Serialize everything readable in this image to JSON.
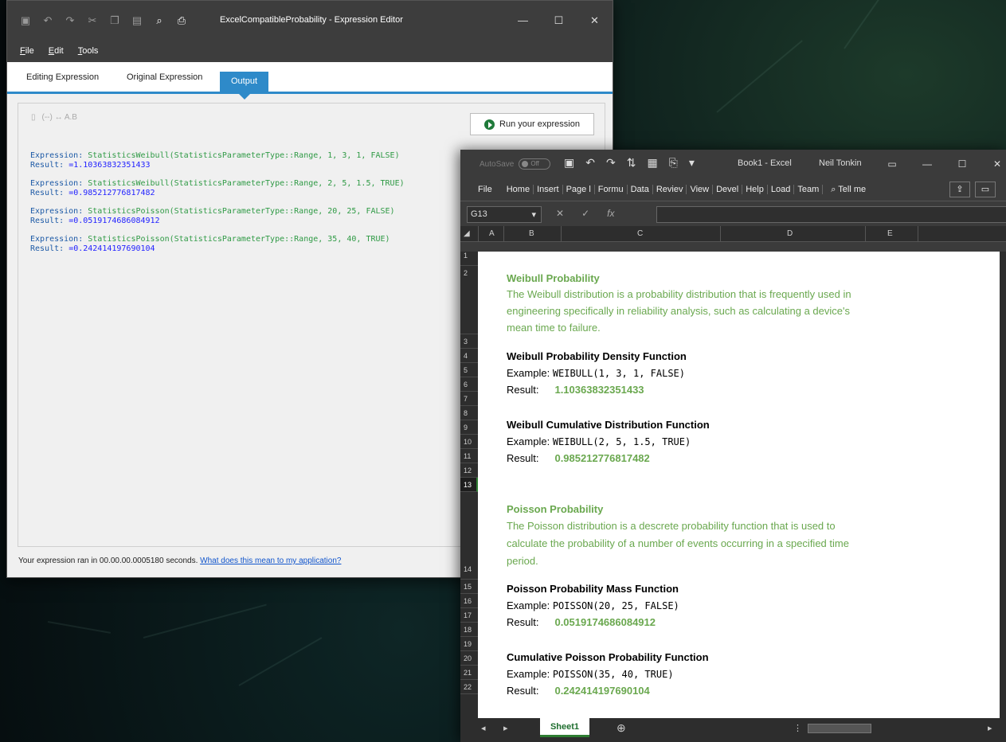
{
  "editor": {
    "title": "ExcelCompatibleProbability - Expression Editor",
    "menu": [
      "File",
      "Edit",
      "Tools"
    ],
    "tabs": [
      "Editing Expression",
      "Original Expression",
      "Output"
    ],
    "run_label": "Run your expression",
    "tools_icons": [
      "doc-icon",
      "braces-icon",
      "arrows-icon",
      "ab-icon"
    ],
    "tools_text": "(--) ↔ A.B",
    "entries": [
      {
        "expr_label": "Expression:",
        "expr": "StatisticsWeibull(StatisticsParameterType::Range, 1, 3, 1, FALSE)",
        "res_label": "Result:",
        "res": "=1.10363832351433"
      },
      {
        "expr_label": "Expression:",
        "expr": "StatisticsWeibull(StatisticsParameterType::Range, 2, 5, 1.5, TRUE)",
        "res_label": "Result:",
        "res": "=0.985212776817482"
      },
      {
        "expr_label": "Expression:",
        "expr": "StatisticsPoisson(StatisticsParameterType::Range, 20, 25, FALSE)",
        "res_label": "Result:",
        "res": "=0.0519174686084912"
      },
      {
        "expr_label": "Expression:",
        "expr": "StatisticsPoisson(StatisticsParameterType::Range, 35, 40, TRUE)",
        "res_label": "Result:",
        "res": "=0.242414197690104"
      }
    ],
    "status_text": "Your expression ran in 00.00.00.0005180 seconds.",
    "status_link": "What does this mean to my application?"
  },
  "excel": {
    "autosave": "AutoSave",
    "toggle": "Off",
    "book": "Book1 - Excel",
    "user": "Neil Tonkin",
    "ribbon": [
      "File",
      "Home",
      "Insert",
      "Page l",
      "Formu",
      "Data",
      "Reviev",
      "View",
      "Devel",
      "Help",
      "Load",
      "Team"
    ],
    "tellme": "Tell me",
    "namebox": "G13",
    "columns": [
      "A",
      "B",
      "C",
      "D",
      "E"
    ],
    "rows": [
      "1",
      "2",
      "3",
      "4",
      "5",
      "6",
      "7",
      "8",
      "9",
      "10",
      "11",
      "12",
      "13",
      "14",
      "15",
      "16",
      "17",
      "18",
      "19",
      "20",
      "21",
      "22"
    ],
    "selected_row": "13",
    "sheet_tab": "Sheet1",
    "content": {
      "weibull_title": "Weibull Probability",
      "weibull_desc1": "The Weibull distribution is a probability distribution that is frequently used in",
      "weibull_desc2": "engineering specifically in reliability analysis, such as calculating a device's",
      "weibull_desc3": "mean time to failure.",
      "wpdf_title": "Weibull Probability Density Function",
      "example_label": "Example:",
      "result_label": "Result:",
      "wpdf_example": "WEIBULL(1, 3, 1, FALSE)",
      "wpdf_result": "1.10363832351433",
      "wcdf_title": "Weibull Cumulative Distribution Function",
      "wcdf_example": "WEIBULL(2, 5, 1.5, TRUE)",
      "wcdf_result": "0.985212776817482",
      "poisson_title": "Poisson Probability",
      "poisson_desc1": "The Poisson distribution is a descrete probability function that is used to",
      "poisson_desc2": "calculate the probability of a number of events occurring in a specified time",
      "poisson_desc3": "period.",
      "ppmf_title": "Poisson Probability Mass Function",
      "ppmf_example": "POISSON(20, 25, FALSE)",
      "ppmf_result": "0.0519174686084912",
      "cppf_title": "Cumulative Poisson Probability Function",
      "cppf_example": "POISSON(35, 40, TRUE)",
      "cppf_result": "0.242414197690104"
    }
  }
}
